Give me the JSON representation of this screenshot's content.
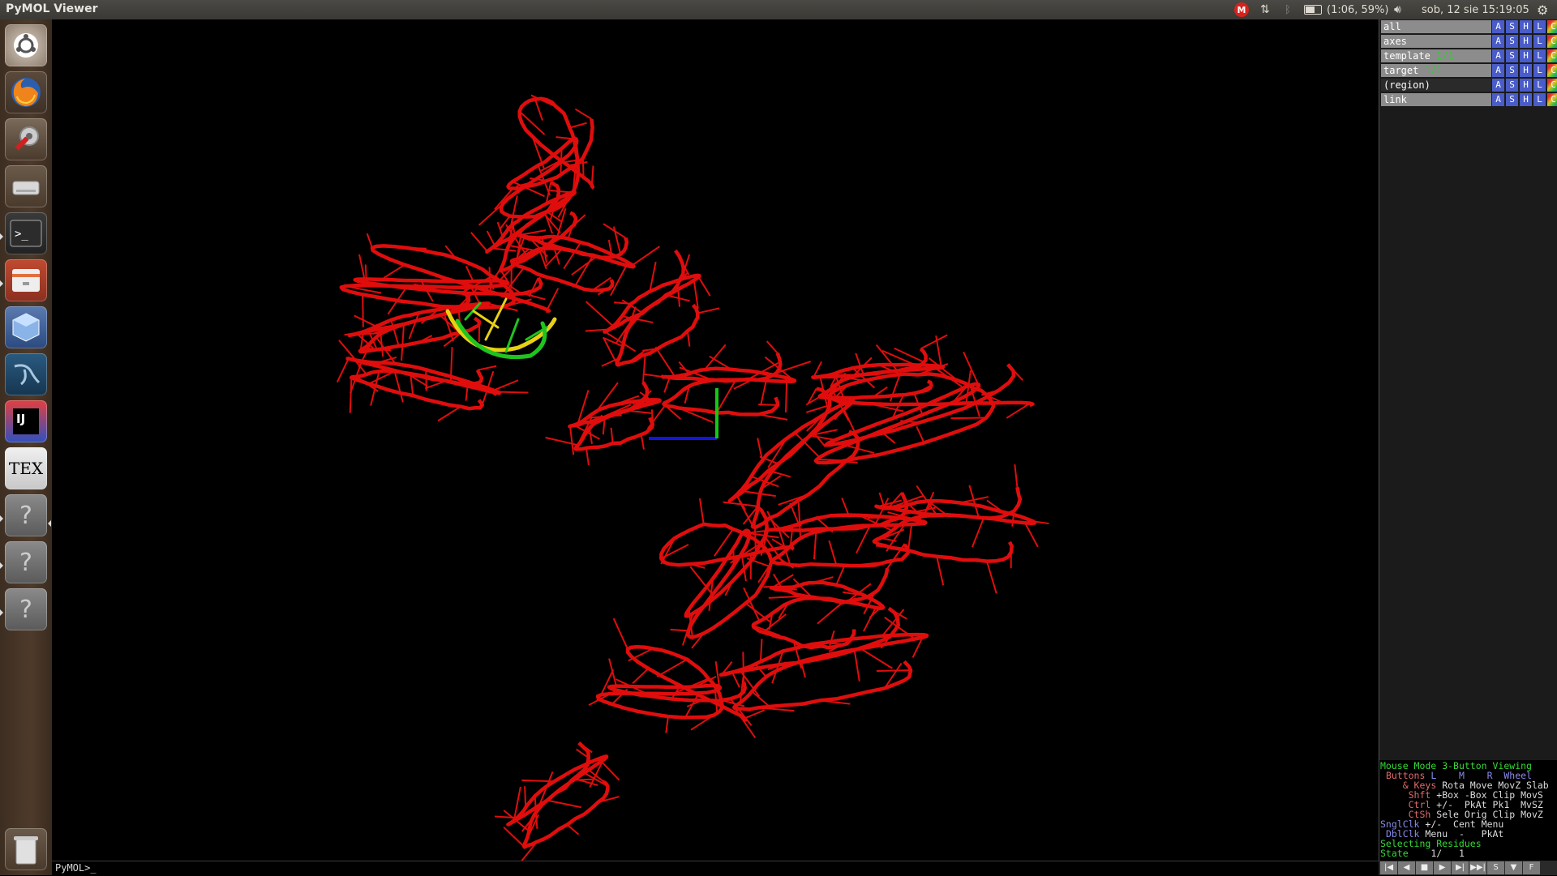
{
  "app": {
    "title": "PyMOL Viewer"
  },
  "topbar": {
    "mail_icon_letter": "M",
    "battery_text": "(1:06, 59%)",
    "battery_level": 0.59,
    "clock": "sob, 12 sie 15:19:05"
  },
  "launcher": {
    "items": [
      {
        "name": "ubuntu-dash-icon"
      },
      {
        "name": "firefox-icon"
      },
      {
        "name": "system-settings-icon"
      },
      {
        "name": "drive-icon"
      },
      {
        "name": "terminal-icon"
      },
      {
        "name": "file-manager-icon"
      },
      {
        "name": "virtualbox-icon"
      },
      {
        "name": "mysql-workbench-icon"
      },
      {
        "name": "intellij-icon",
        "label": "IJ"
      },
      {
        "name": "texmaker-icon",
        "label": "TEX"
      },
      {
        "name": "unknown-app-icon",
        "label": "?"
      },
      {
        "name": "unknown-app-icon",
        "label": "?"
      },
      {
        "name": "unknown-app-icon",
        "label": "?"
      }
    ],
    "trash": {
      "name": "trash-icon"
    }
  },
  "objects": [
    {
      "name": "all",
      "frac": "",
      "selected": false
    },
    {
      "name": "axes",
      "frac": "",
      "selected": false
    },
    {
      "name": "template",
      "frac": "1/1",
      "selected": false
    },
    {
      "name": "target",
      "frac": "1/1",
      "selected": false
    },
    {
      "name": "(region)",
      "frac": "",
      "selected": true
    },
    {
      "name": "link",
      "frac": "",
      "selected": false
    }
  ],
  "object_buttons": [
    "A",
    "S",
    "H",
    "L",
    "C"
  ],
  "mouse_mode": {
    "line1_label": "Mouse Mode",
    "line1_value": "3-Button Viewing",
    "buttons_label": "Buttons",
    "buttons_cols": "L    M    R  Wheel",
    "rows": [
      {
        "key": "& Keys",
        "vals": "Rota Move MovZ Slab"
      },
      {
        "key": "Shft",
        "vals": "+Box -Box Clip MovS"
      },
      {
        "key": "Ctrl",
        "vals": "+/-  PkAt Pk1  MvSZ"
      },
      {
        "key": "CtSh",
        "vals": "Sele Orig Clip MovZ"
      },
      {
        "key": "SnglClk",
        "vals": "+/-  Cent Menu"
      },
      {
        "key": "DblClk",
        "vals": "Menu  -   PkAt"
      }
    ],
    "selecting": "Selecting Residues",
    "state_label": "State",
    "state_value": "1/   1"
  },
  "playback": [
    "|◀",
    "◀",
    "■",
    "▶",
    "▶|",
    "▶▶|",
    "S",
    "▼",
    "F"
  ],
  "command": {
    "prompt": "PyMOL>_"
  },
  "colors": {
    "rna": "#e00d0d",
    "highlight_yellow": "#e8d012",
    "highlight_green": "#1fc41f",
    "axis_blue": "#1414e0",
    "axis_green": "#14c814"
  }
}
